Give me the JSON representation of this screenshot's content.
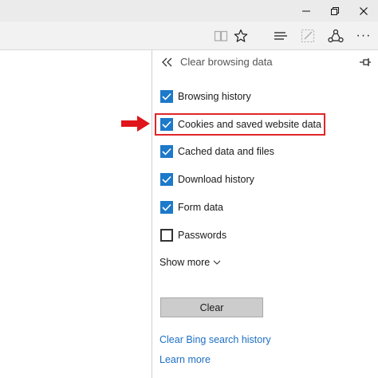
{
  "window": {
    "controls": [
      "minimize",
      "restore",
      "close"
    ]
  },
  "toolbar": {
    "icons": [
      "reading-view-icon",
      "favorite-star-icon",
      "hub-icon",
      "web-note-icon",
      "share-icon",
      "more-icon"
    ],
    "more_label": "···"
  },
  "hub": {
    "title": "Clear browsing data",
    "back_icon": "«",
    "options": [
      {
        "label": "Browsing history",
        "checked": true
      },
      {
        "label": "Cookies and saved website data",
        "checked": true,
        "highlighted": true
      },
      {
        "label": "Cached data and files",
        "checked": true
      },
      {
        "label": "Download history",
        "checked": true
      },
      {
        "label": "Form data",
        "checked": true
      },
      {
        "label": "Passwords",
        "checked": false
      }
    ],
    "show_more": "Show more",
    "clear_button": "Clear",
    "links": {
      "bing": "Clear Bing search history",
      "learn": "Learn more"
    }
  },
  "colors": {
    "accent": "#1d79c9",
    "highlight": "#e0262b",
    "link": "#1e6fc2"
  }
}
